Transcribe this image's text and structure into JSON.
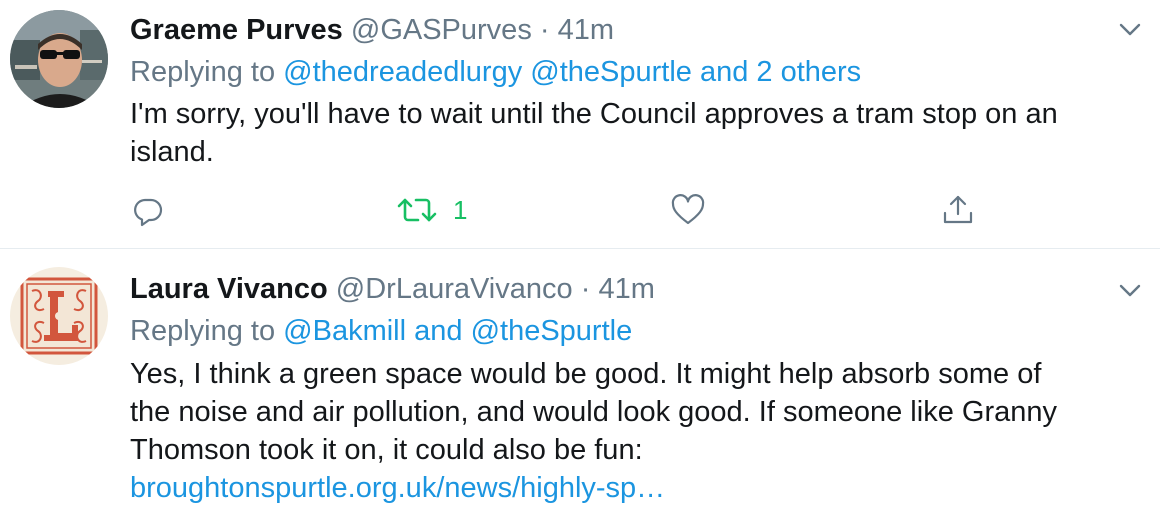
{
  "tweets": [
    {
      "name": "Graeme Purves",
      "handle": "@GASPurves",
      "separator": "·",
      "time": "41m",
      "replying_prefix": "Replying to",
      "replying_links": "@thedreadedlurgy @theSpurtle and 2 others",
      "text_line1": "I'm sorry, you'll have to wait until the Council approves a tram stop on an",
      "text_line2": "island.",
      "retweet_count": "1",
      "icons": [
        "chevron-down-icon",
        "reply-icon",
        "retweet-icon",
        "like-icon",
        "share-icon"
      ]
    },
    {
      "name": "Laura Vivanco",
      "handle": "@DrLauraVivanco",
      "separator": "·",
      "time": "41m",
      "replying_prefix": "Replying to",
      "replying_link1": "@Bakmill",
      "replying_and": "and",
      "replying_link2": "@theSpurtle",
      "text_line1": "Yes, I think a green space would be good. It might help absorb some of",
      "text_line2": "the noise and air pollution, and would look good. If someone like Granny",
      "text_line3": "Thomson took it on, it could also be fun:",
      "url": "broughtonspurtle.org.uk/news/highly-sp…",
      "icons": [
        "chevron-down-icon"
      ]
    }
  ],
  "colors": {
    "link": "#1b95e0",
    "muted": "#657786",
    "retweet_active": "#17bf63",
    "text": "#14171a",
    "divider": "#e6ecf0"
  }
}
